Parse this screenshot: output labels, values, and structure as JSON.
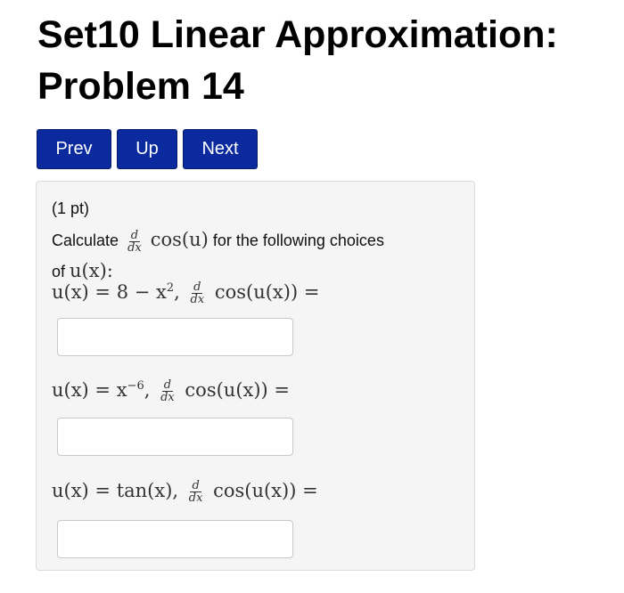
{
  "title": {
    "line1": "Set10 Linear Approximation:",
    "line2": "Problem 14"
  },
  "nav": {
    "prev_label": "Prev",
    "up_label": "Up",
    "next_label": "Next",
    "button_color": "#0b2a9e"
  },
  "problem": {
    "points": "(1 pt)",
    "intro_before": "Calculate",
    "intro_after": "for the following choices",
    "intro_line2": "of",
    "derivative": {
      "num": "d",
      "den": "dx"
    },
    "cos_u": "cos(u)",
    "u_of_x": "u(x)",
    "colon": ":",
    "questions": [
      {
        "u_def": "u(x) = 8 − x",
        "exponent": "2",
        "tail": "cos(u(x)) =",
        "answer": "",
        "placeholder": ""
      },
      {
        "u_def": "u(x) = x",
        "exponent": "−6",
        "tail": "cos(u(x)) =",
        "answer": "",
        "placeholder": ""
      },
      {
        "u_def": "u(x) = tan(x)",
        "exponent": "",
        "tail": "cos(u(x)) =",
        "answer": "",
        "placeholder": ""
      }
    ]
  }
}
